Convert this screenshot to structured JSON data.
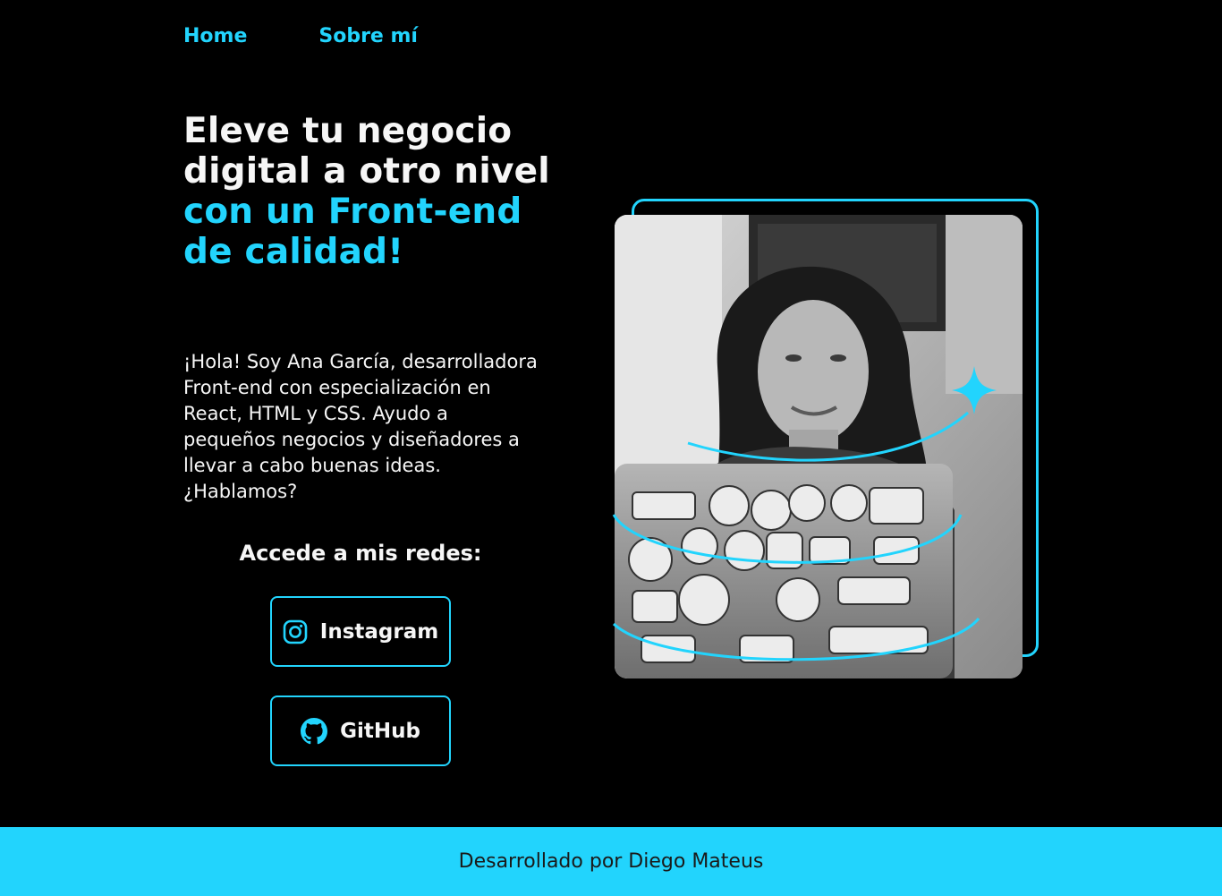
{
  "nav": {
    "items": [
      {
        "label": "Home"
      },
      {
        "label": "Sobre mí"
      }
    ]
  },
  "hero": {
    "headline_part1": "Eleve tu negocio digital a otro nivel ",
    "headline_accent": "con un Front-end de calidad!",
    "intro": "¡Hola! Soy Ana García, desarrolladora Front-end con especialización en React, HTML y CSS. Ayudo a pequeños negocios y diseñadores a llevar a cabo buenas ideas. ¿Hablamos?"
  },
  "social": {
    "title": "Accede a mis redes:",
    "buttons": [
      {
        "label": "Instagram",
        "icon": "instagram-icon"
      },
      {
        "label": "GitHub",
        "icon": "github-icon"
      }
    ]
  },
  "footer": {
    "text": "Desarrollado por Diego Mateus"
  },
  "colors": {
    "accent": "#22D4FD",
    "background": "#000000",
    "text": "#F6F6F6"
  }
}
